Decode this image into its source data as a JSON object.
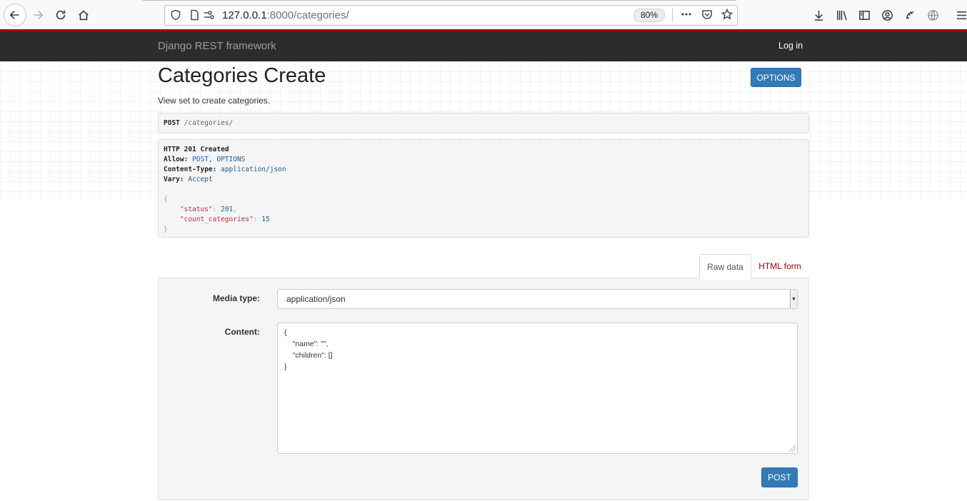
{
  "browser": {
    "url_host": "127.0.0.1",
    "url_rest": ":8000/categories/",
    "zoom": "80%"
  },
  "navbar": {
    "brand": "Django REST framework",
    "login": "Log in"
  },
  "page": {
    "title": "Categories Create",
    "options_button": "OPTIONS",
    "description": "View set to create categories."
  },
  "request": {
    "method": "POST",
    "path": "/categories/"
  },
  "response": {
    "status_line": "HTTP 201 Created",
    "headers": [
      {
        "key": "Allow:",
        "value": "POST, OPTIONS"
      },
      {
        "key": "Content-Type:",
        "value": "application/json"
      },
      {
        "key": "Vary:",
        "value": "Accept"
      }
    ],
    "body": [
      {
        "key": "\"status\"",
        "value": "201",
        "comma": ","
      },
      {
        "key": "\"count_categories\"",
        "value": "15",
        "comma": ""
      }
    ]
  },
  "tabs": {
    "raw": "Raw data",
    "html": "HTML form"
  },
  "form": {
    "media_label": "Media type:",
    "media_value": "application/json",
    "content_label": "Content:",
    "content_value": "{\n    \"name\": \"\",\n    \"children\": []\n}",
    "submit": "POST"
  },
  "colors": {
    "accent_red": "#a30000",
    "primary_blue": "#337ab7",
    "navbar": "#2c2c2c"
  }
}
